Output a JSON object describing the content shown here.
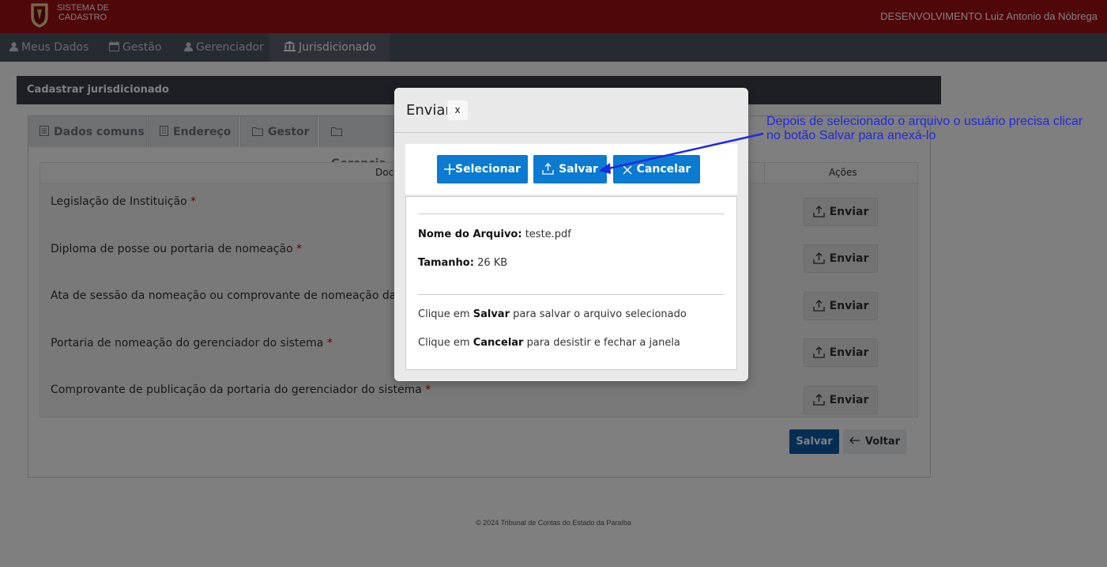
{
  "header": {
    "brand_line1": "SISTEMA DE",
    "brand_line2": "CADASTRO",
    "user": "DESENVOLVIMENTO Luiz Antonio da Nóbrega"
  },
  "nav": {
    "items": [
      {
        "label": "Meus Dados",
        "icon": "user-icon"
      },
      {
        "label": "Gestão",
        "icon": "calendar-icon"
      },
      {
        "label": "Gerenciador",
        "icon": "user-icon"
      },
      {
        "label": "Jurisdicionado",
        "icon": "institution-icon"
      }
    ]
  },
  "card": {
    "title": "Cadastrar jurisdicionado",
    "tabs": [
      {
        "label": "Dados comuns",
        "icon": "document-icon"
      },
      {
        "label": "Endereço",
        "icon": "building-icon"
      },
      {
        "label": "Gestor",
        "icon": "folder-icon"
      },
      {
        "label": "Gerencia",
        "icon": "folder-icon"
      }
    ],
    "table": {
      "col_doc": "Docu",
      "col_acoes": "Ações",
      "rows": [
        {
          "label": "Legislação de Instituição",
          "required": "*",
          "button": "Enviar"
        },
        {
          "label": "Diploma de posse ou portaria de nomeação",
          "required": "*",
          "button": "Enviar"
        },
        {
          "label": "Ata de sessão da nomeação ou comprovante de nomeação da port",
          "required": "",
          "button": "Enviar"
        },
        {
          "label": "Portaria de nomeação do gerenciador do sistema",
          "required": "*",
          "button": "Enviar"
        },
        {
          "label": "Comprovante de publicação da portaria do gerenciador do sistema",
          "required": "*",
          "button": "Enviar"
        }
      ]
    },
    "save_label": "Salvar",
    "back_label": "Voltar"
  },
  "footer": "© 2024 Tribunal de Contas do Estado da Paraíba",
  "modal": {
    "title": "Enviar",
    "close_label": "x",
    "buttons": {
      "select": "Selecionar",
      "save": "Salvar",
      "cancel": "Cancelar"
    },
    "file_name_label": "Nome do Arquivo:",
    "file_name": "teste.pdf",
    "size_label": "Tamanho:",
    "size": "26 KB",
    "hint1_pre": "Clique em",
    "hint1_bold": "Salvar",
    "hint1_post": "para salvar o arquivo selecionado",
    "hint2_pre": "Clique em",
    "hint2_bold": "Cancelar",
    "hint2_post": "para desistir e fechar a janela"
  },
  "annotation": {
    "line1": "Depois de selecionado o arquivo o usuário precisa clicar",
    "line2": "no botão Salvar para anexá-lo",
    "color": "#1f2ae0"
  },
  "colors": {
    "brand_red": "#a00f14",
    "primary": "#0b7ad1"
  }
}
